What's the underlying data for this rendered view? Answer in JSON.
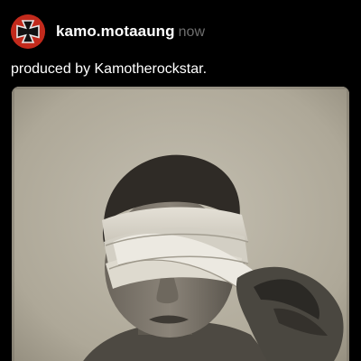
{
  "post": {
    "username": "kamo.motaaung",
    "timestamp": "now",
    "caption": "produced by Kamotherockstar.",
    "avatar_icon": "iron-cross-icon",
    "media_icon": "photo-blindfolded-boy"
  },
  "colors": {
    "background": "#000000",
    "username": "#ffffff",
    "timestamp": "#6e6e6e",
    "caption": "#ffffff",
    "avatar_bg": "#c22a1c"
  }
}
